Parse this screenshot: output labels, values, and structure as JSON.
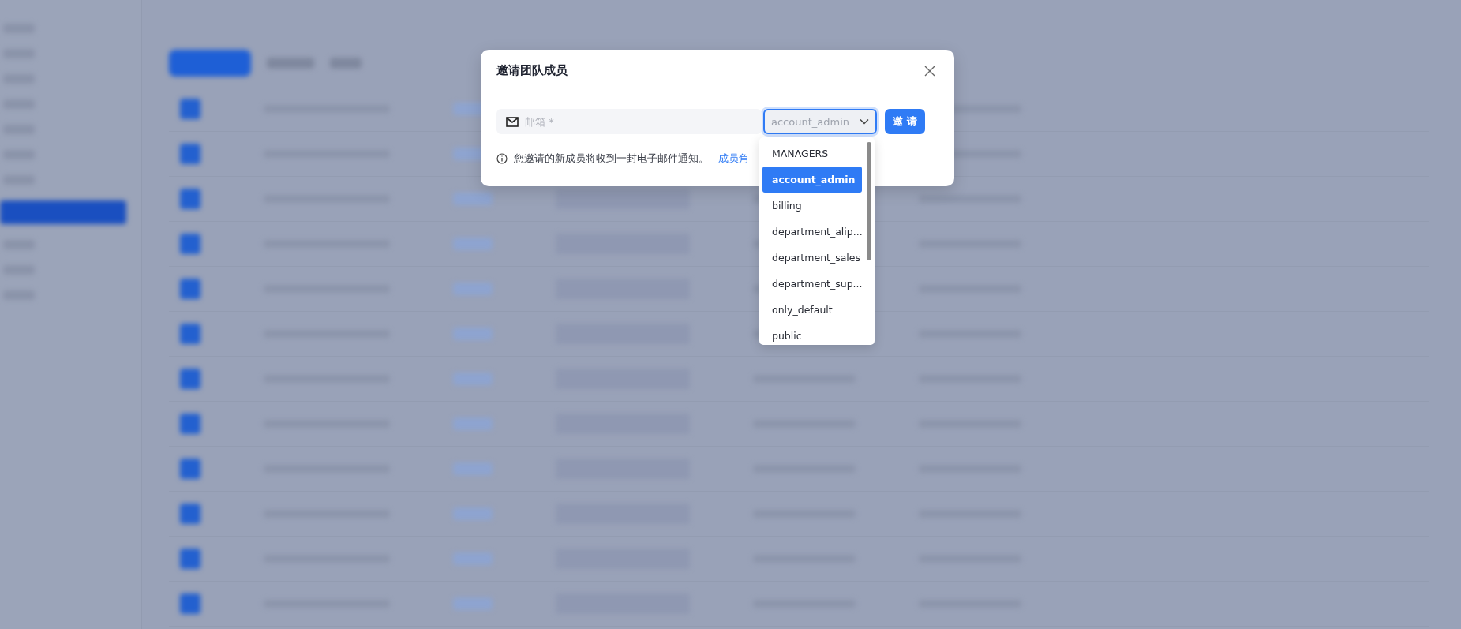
{
  "dialog": {
    "title": "邀请团队成员",
    "email_field": {
      "placeholder": "邮箱 *"
    },
    "role_select": {
      "value": "account_admin",
      "open": true
    },
    "invite_button": "邀 请",
    "notice": "您邀请的新成员将收到一封电子邮件通知。",
    "notice_link": "成员角"
  },
  "role_dropdown": {
    "group": "MANAGERS",
    "options": [
      {
        "label": "account_admin",
        "selected": true
      },
      {
        "label": "billing",
        "selected": false
      },
      {
        "label": "department_alip...",
        "selected": false
      },
      {
        "label": "department_sales",
        "selected": false
      },
      {
        "label": "department_sup...",
        "selected": false
      },
      {
        "label": "only_default",
        "selected": false
      },
      {
        "label": "public",
        "selected": false
      }
    ]
  }
}
